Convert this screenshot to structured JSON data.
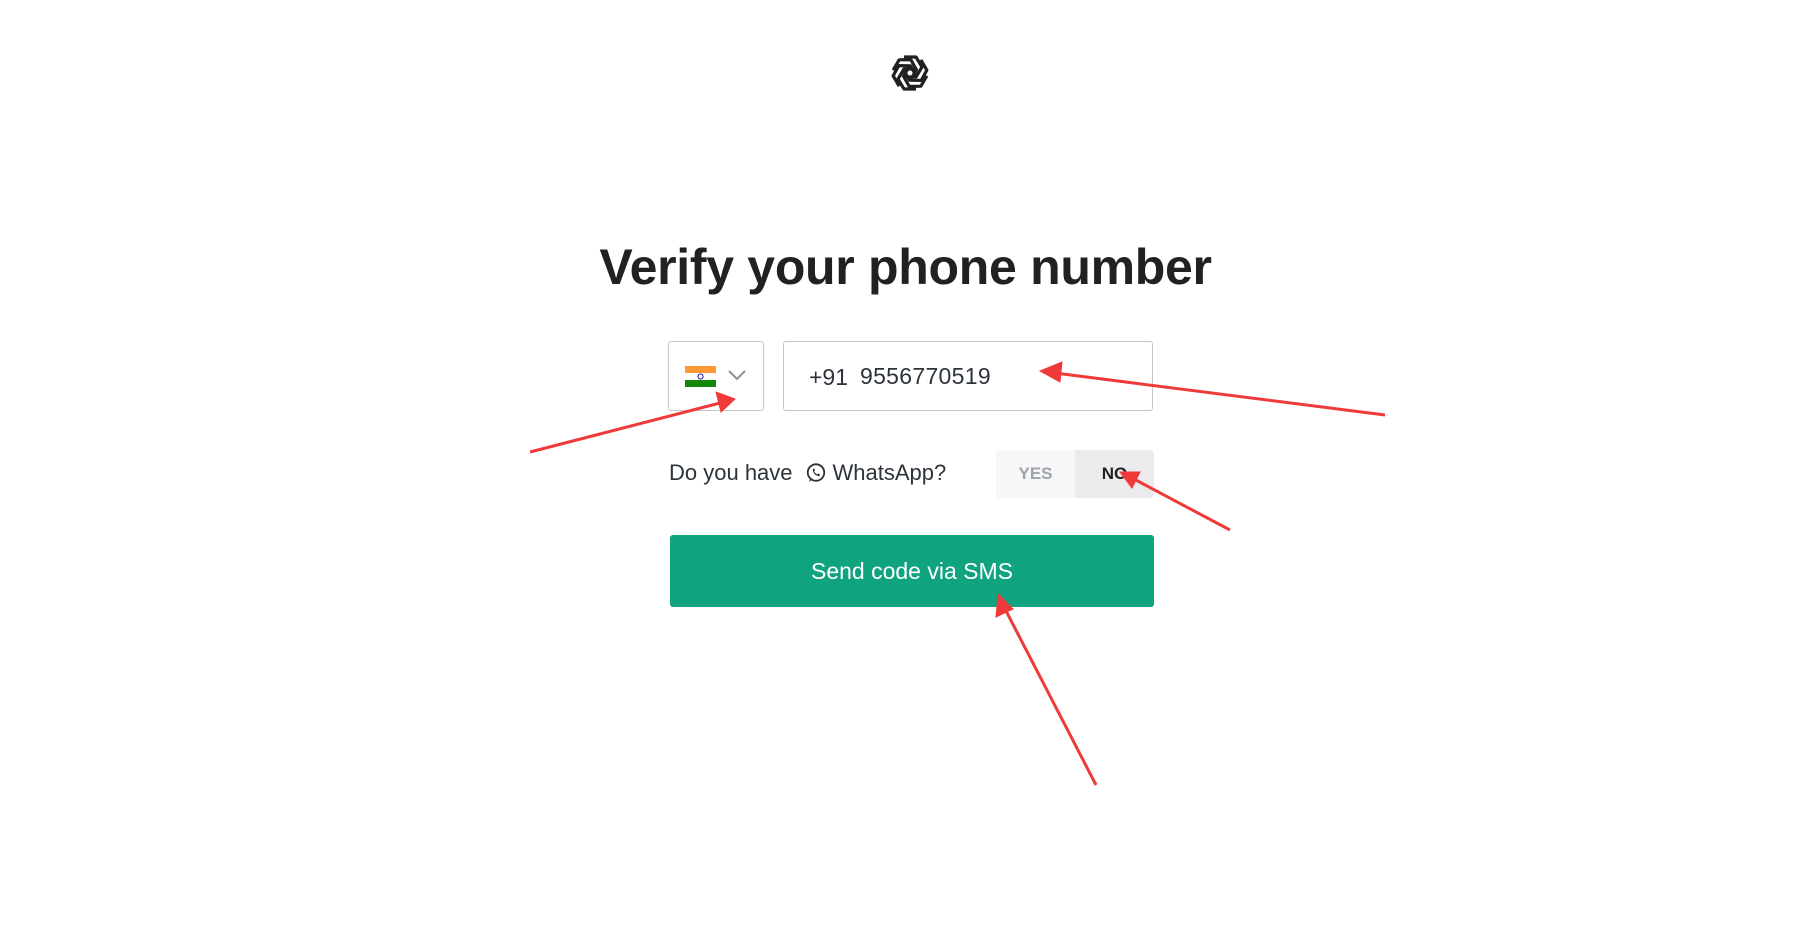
{
  "logo": {
    "icon": "openai-logo-icon"
  },
  "heading": {
    "title": "Verify your phone number"
  },
  "country_select": {
    "selected_flag": "india-flag-icon",
    "dropdown_icon": "chevron-down-icon"
  },
  "phone": {
    "dial_code": "+91",
    "value": "9556770519"
  },
  "whatsapp": {
    "prefix": "Do you have",
    "icon": "whatsapp-icon",
    "label": "WhatsApp?",
    "options": [
      "YES",
      "NO"
    ],
    "selected": "NO"
  },
  "actions": {
    "send_label": "Send code via SMS"
  },
  "colors": {
    "primary_button": "#10a37f",
    "annotation_arrow": "#f03a3a"
  }
}
